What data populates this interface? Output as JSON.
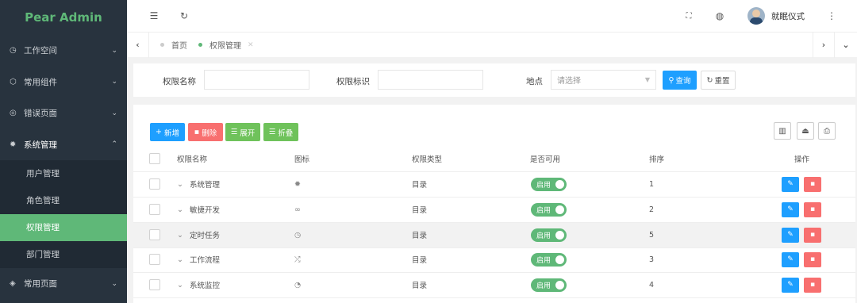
{
  "app": {
    "title": "Pear Admin"
  },
  "sidebar": {
    "items": [
      {
        "label": "工作空间",
        "icon": "dashboard-icon"
      },
      {
        "label": "常用组件",
        "icon": "cube-icon"
      },
      {
        "label": "错误页面",
        "icon": "shield-check-icon"
      },
      {
        "label": "系统管理",
        "icon": "gear-icon"
      },
      {
        "label": "常用页面",
        "icon": "layers-icon"
      }
    ],
    "subitems": [
      {
        "label": "用户管理"
      },
      {
        "label": "角色管理"
      },
      {
        "label": "权限管理"
      },
      {
        "label": "部门管理"
      }
    ]
  },
  "header": {
    "username": "就眠仪式"
  },
  "tabs": [
    {
      "label": "首页"
    },
    {
      "label": "权限管理"
    }
  ],
  "search": {
    "name_label": "权限名称",
    "code_label": "权限标识",
    "location_label": "地点",
    "location_placeholder": "请选择",
    "query_label": "查询",
    "reset_label": "重置"
  },
  "toolbar": {
    "add_label": "新增",
    "delete_label": "删除",
    "expand_label": "展开",
    "collapse_label": "折叠"
  },
  "table": {
    "columns": [
      "权限名称",
      "图标",
      "权限类型",
      "是否可用",
      "排序",
      "操作"
    ],
    "rows": [
      {
        "name": "系统管理",
        "icon": "gear-icon",
        "type": "目录",
        "enabled": "启用",
        "sort": "1"
      },
      {
        "name": "敏捷开发",
        "icon": "link-icon",
        "type": "目录",
        "enabled": "启用",
        "sort": "2"
      },
      {
        "name": "定时任务",
        "icon": "clock-icon",
        "type": "目录",
        "enabled": "启用",
        "sort": "5"
      },
      {
        "name": "工作流程",
        "icon": "flow-icon",
        "type": "目录",
        "enabled": "启用",
        "sort": "3"
      },
      {
        "name": "系统监控",
        "icon": "monitor-icon",
        "type": "目录",
        "enabled": "启用",
        "sort": "4"
      }
    ]
  },
  "colors": {
    "brand": "#5fb878",
    "primary": "#1e9fff",
    "danger": "#ff5722",
    "sidebar": "#28333e"
  }
}
